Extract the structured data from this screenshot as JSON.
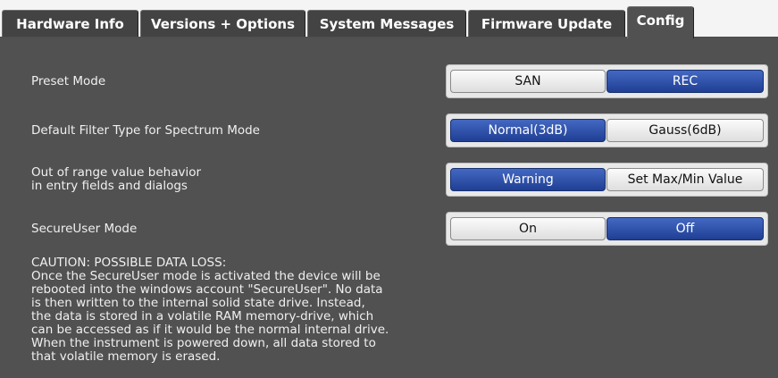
{
  "tabs": [
    {
      "label": "Hardware Info",
      "active": false
    },
    {
      "label": "Versions + Options",
      "active": false
    },
    {
      "label": "System Messages",
      "active": false
    },
    {
      "label": "Firmware Update",
      "active": false
    },
    {
      "label": "Config",
      "active": true
    }
  ],
  "settings": {
    "preset_mode": {
      "label": "Preset Mode",
      "options": [
        "SAN",
        "REC"
      ],
      "selected": "REC"
    },
    "default_filter": {
      "label": "Default Filter Type for Spectrum Mode",
      "options": [
        "Normal(3dB)",
        "Gauss(6dB)"
      ],
      "selected": "Normal(3dB)"
    },
    "out_of_range": {
      "label_line1": "Out of range value behavior",
      "label_line2": "in entry fields and dialogs",
      "options": [
        "Warning",
        "Set Max/Min Value"
      ],
      "selected": "Warning"
    },
    "secureuser_mode": {
      "label": "SecureUser Mode",
      "options": [
        "On",
        "Off"
      ],
      "selected": "Off"
    }
  },
  "caution": {
    "lines": [
      "CAUTION: POSSIBLE DATA LOSS:",
      "Once the SecureUser mode is activated the device will be",
      "rebooted into the windows account \"SecureUser\". No data",
      "is then written to the internal solid state drive. Instead,",
      "the data is stored in a volatile RAM memory-drive, which",
      "can be accessed as if it would be the normal internal drive.",
      "When the instrument is powered down, all data stored to",
      "that volatile memory is erased."
    ]
  },
  "colors": {
    "panel_bg": "#515151",
    "tab_bg": "#434343",
    "selected_option": "#2c4fa8",
    "unselected_option": "#ececec"
  }
}
